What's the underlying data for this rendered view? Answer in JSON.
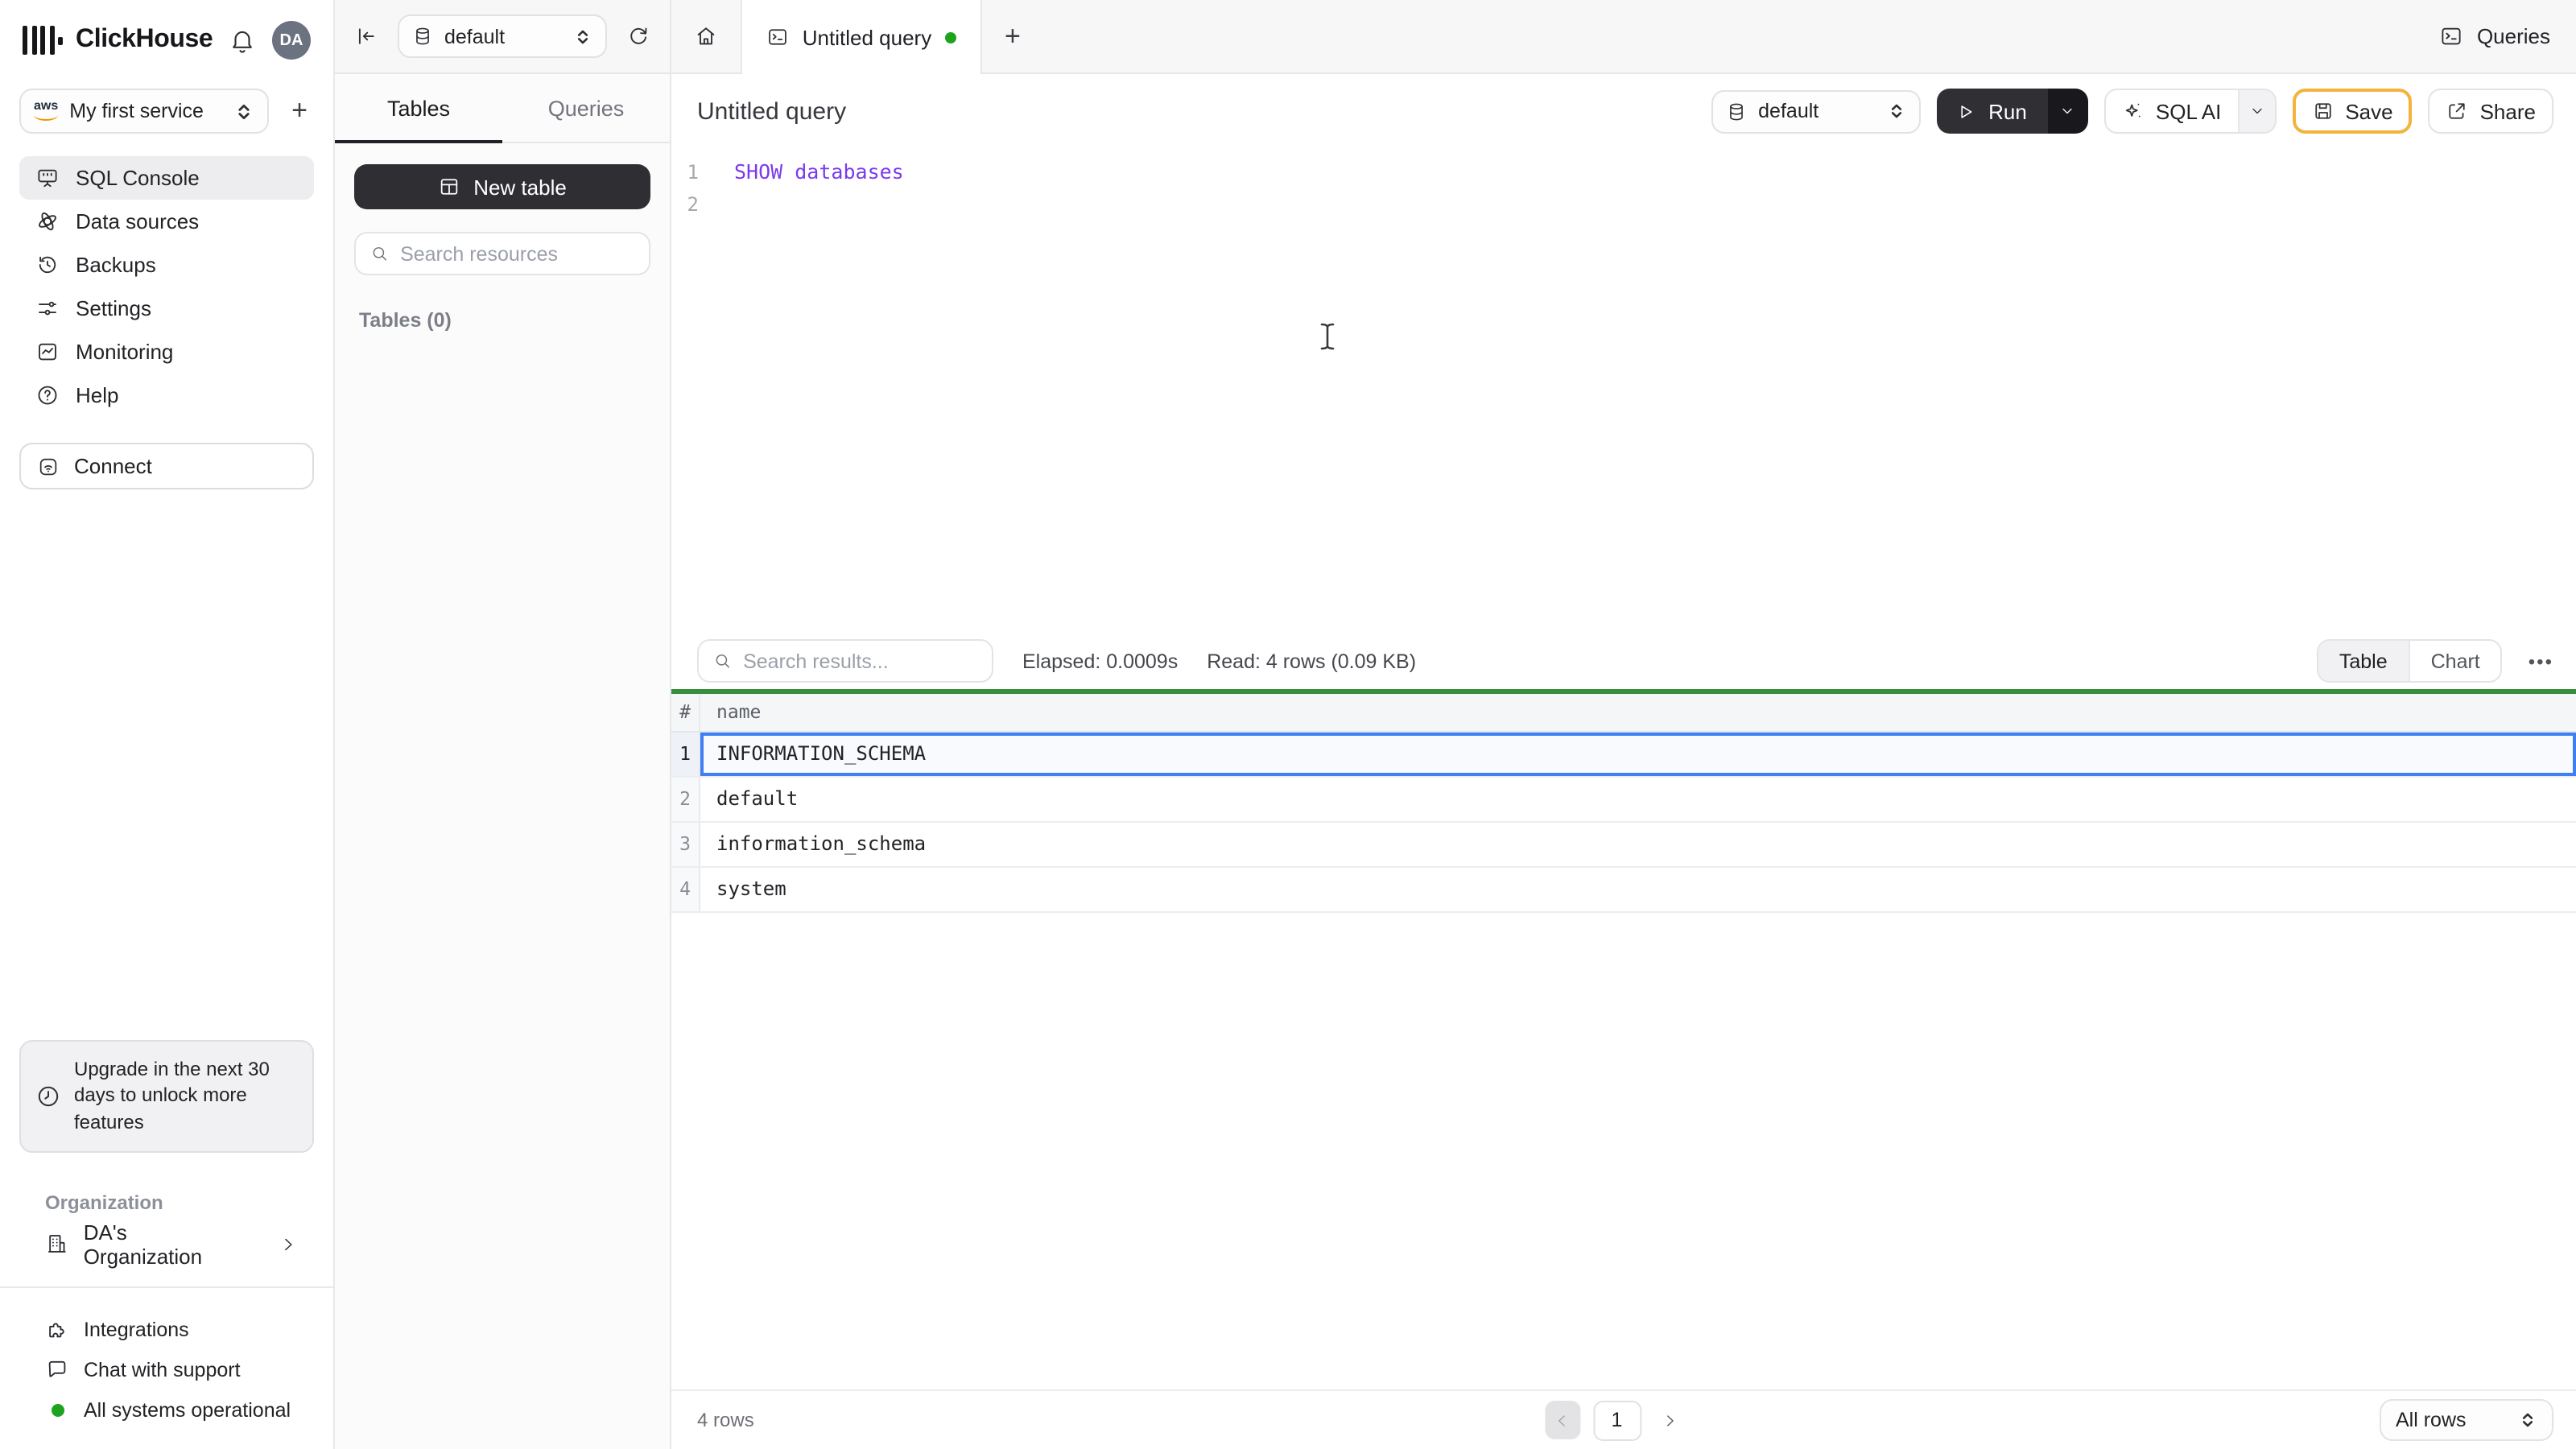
{
  "colors": {
    "brand_dark": "#17171a",
    "run_button": "#302f33",
    "save_border": "#f3b33d",
    "success_bar_green": "#388e3c",
    "status_green": "#1ea31e",
    "selection_blue": "#3e80f1",
    "sql_keyword_purple": "#7c3aed",
    "avatar_bg": "#6b7280",
    "aws_orange": "#f59300"
  },
  "sidebar": {
    "brand": "ClickHouse",
    "avatar_initials": "DA",
    "service_selector": {
      "label": "My first service",
      "provider": "aws"
    },
    "nav": [
      {
        "label": "SQL Console"
      },
      {
        "label": "Data sources"
      },
      {
        "label": "Backups"
      },
      {
        "label": "Settings"
      },
      {
        "label": "Monitoring"
      },
      {
        "label": "Help"
      }
    ],
    "connect_label": "Connect",
    "upgrade_notice": "Upgrade in the next 30 days to unlock more features",
    "organization_section_label": "Organization",
    "organization_name": "DA's Organization",
    "footer": {
      "integrations": "Integrations",
      "chat": "Chat with support",
      "status": "All systems operational"
    }
  },
  "explorer": {
    "database_selector": "default",
    "tabs": {
      "tables": "Tables",
      "queries": "Queries"
    },
    "active_tab": "Tables",
    "new_table_label": "New table",
    "search_placeholder": "Search resources",
    "tables_count_label": "Tables (0)"
  },
  "topbar": {
    "tab_title": "Untitled query",
    "queries_label": "Queries"
  },
  "query_editor": {
    "title": "Untitled query",
    "database_selector": "default",
    "run_label": "Run",
    "sql_ai_label": "SQL AI",
    "save_label": "Save",
    "share_label": "Share",
    "code_lines": [
      {
        "number": "1",
        "text": "SHOW databases"
      },
      {
        "number": "2",
        "text": ""
      }
    ]
  },
  "results": {
    "search_placeholder": "Search results...",
    "elapsed_label": "Elapsed: 0.0009s",
    "read_label": "Read: 4 rows (0.09 KB)",
    "view_tabs": {
      "table": "Table",
      "chart": "Chart"
    },
    "active_view": "Table",
    "more_label": "•••",
    "table": {
      "columns": {
        "index": "#",
        "name": "name"
      },
      "rows": [
        {
          "index": "1",
          "name": "INFORMATION_SCHEMA",
          "selected": true
        },
        {
          "index": "2",
          "name": "default",
          "selected": false
        },
        {
          "index": "3",
          "name": "information_schema",
          "selected": false
        },
        {
          "index": "4",
          "name": "system",
          "selected": false
        }
      ]
    },
    "footer": {
      "row_count_label": "4 rows",
      "current_page": "1",
      "page_size_label": "All rows"
    }
  }
}
